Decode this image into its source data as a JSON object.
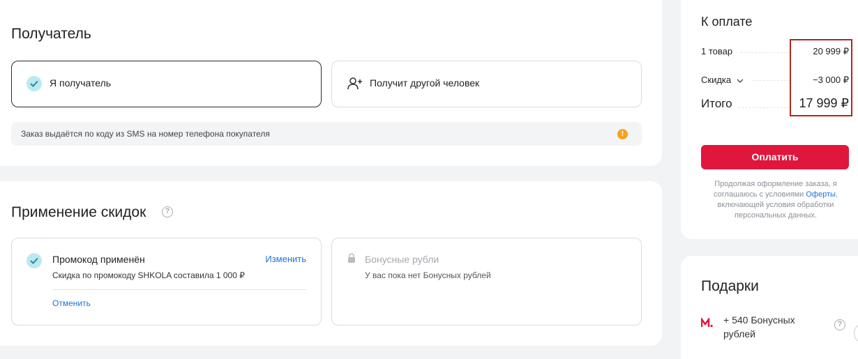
{
  "recipient": {
    "title": "Получатель",
    "option_self": "Я получатель",
    "option_other": "Получит другой человек",
    "info": "Заказ выдаётся по коду из SMS на номер телефона покупателя",
    "info_icon": "!"
  },
  "discounts": {
    "title": "Применение скидок",
    "help_icon": "?",
    "promo": {
      "title": "Промокод применён",
      "change": "Изменить",
      "description": "Скидка по промокоду SHKOLA составила 1 000 ₽",
      "cancel": "Отменить"
    },
    "bonus": {
      "title": "Бонусные рубли",
      "description": "У вас пока нет Бонусных рублей"
    }
  },
  "summary": {
    "title": "К оплате",
    "items_label": "1 товар",
    "items_value": "20 999 ₽",
    "discount_label": "Скидка",
    "discount_value": "−3 000 ₽",
    "total_label": "Итого",
    "total_value": "17 999 ₽",
    "pay_button": "Оплатить",
    "legal_prefix": "Продолжая оформление заказа, я соглашаюсь с условиями ",
    "legal_link": "Оферты",
    "legal_suffix": ", включающей условия обработки персональных данных."
  },
  "gifts": {
    "title": "Подарки",
    "bonus_line1": "+ 540 Бонусных",
    "bonus_line2": "рублей",
    "help_icon": "?"
  },
  "colors": {
    "accent_red": "#e0163d",
    "link_blue": "#1a73d9",
    "check_bg": "#bde8f0",
    "warning": "#f7a21b"
  }
}
